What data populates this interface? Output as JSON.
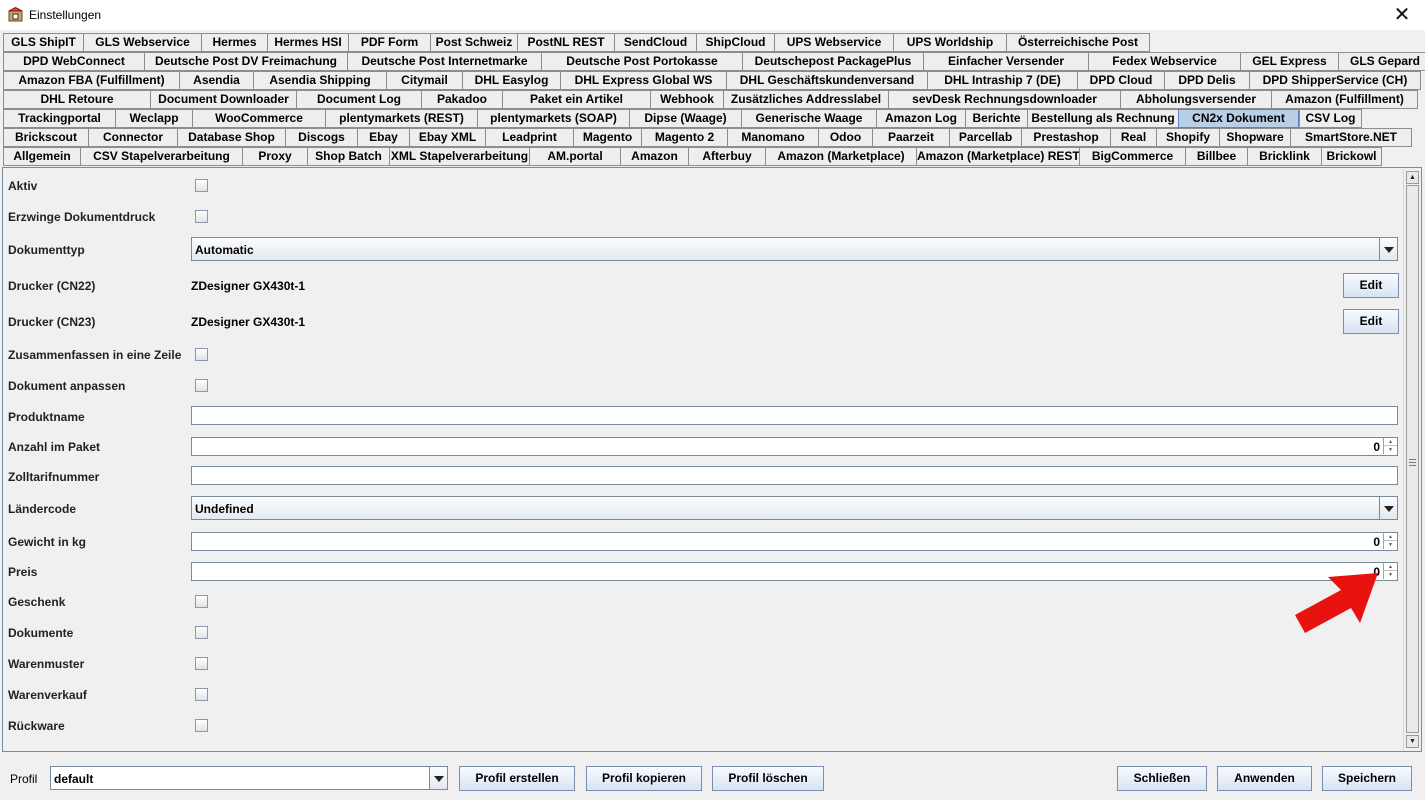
{
  "window": {
    "title": "Einstellungen",
    "close_glyph": "✕"
  },
  "tabs": {
    "row1": [
      "GLS ShipIT",
      "GLS Webservice",
      "Hermes",
      "Hermes HSI",
      "PDF Form",
      "Post Schweiz",
      "PostNL REST",
      "SendCloud",
      "ShipCloud",
      "UPS Webservice",
      "UPS Worldship",
      "Österreichische Post"
    ],
    "row2": [
      "DPD WebConnect",
      "Deutsche Post DV Freimachung",
      "Deutsche Post Internetmarke",
      "Deutsche Post Portokasse",
      "Deutschepost PackagePlus",
      "Einfacher Versender",
      "Fedex Webservice",
      "GEL Express",
      "GLS Gepard"
    ],
    "row3": [
      "Amazon FBA (Fulfillment)",
      "Asendia",
      "Asendia Shipping",
      "Citymail",
      "DHL Easylog",
      "DHL Express Global WS",
      "DHL Geschäftskundenversand",
      "DHL Intraship 7 (DE)",
      "DPD Cloud",
      "DPD Delis",
      "DPD ShipperService (CH)"
    ],
    "row4": [
      "DHL Retoure",
      "Document Downloader",
      "Document Log",
      "Pakadoo",
      "Paket ein Artikel",
      "Webhook",
      "Zusätzliches Addresslabel",
      "sevDesk Rechnungsdownloader",
      "Abholungsversender",
      "Amazon (Fulfillment)"
    ],
    "row5": [
      "Trackingportal",
      "Weclapp",
      "WooCommerce",
      "plentymarkets (REST)",
      "plentymarkets (SOAP)",
      "Dipse (Waage)",
      "Generische Waage",
      "Amazon Log",
      "Berichte",
      "Bestellung als Rechnung",
      "CN2x Dokument",
      "CSV Log"
    ],
    "row6": [
      "Brickscout",
      "Connector",
      "Database Shop",
      "Discogs",
      "Ebay",
      "Ebay XML",
      "Leadprint",
      "Magento",
      "Magento 2",
      "Manomano",
      "Odoo",
      "Paarzeit",
      "Parcellab",
      "Prestashop",
      "Real",
      "Shopify",
      "Shopware",
      "SmartStore.NET"
    ],
    "row7": [
      "Allgemein",
      "CSV Stapelverarbeitung",
      "Proxy",
      "Shop Batch",
      "XML Stapelverarbeitung",
      "AM.portal",
      "Amazon",
      "Afterbuy",
      "Amazon (Marketplace)",
      "Amazon (Marketplace) REST",
      "BigCommerce",
      "Billbee",
      "Bricklink",
      "Brickowl"
    ],
    "selected": "CN2x Dokument"
  },
  "form": {
    "aktiv": "Aktiv",
    "erzwinge": "Erzwinge Dokumentdruck",
    "dokumenttyp_label": "Dokumenttyp",
    "dokumenttyp_value": "Automatic",
    "drucker_cn22_label": "Drucker (CN22)",
    "drucker_cn22_value": "ZDesigner GX430t-1",
    "drucker_cn23_label": "Drucker (CN23)",
    "drucker_cn23_value": "ZDesigner GX430t-1",
    "edit_label": "Edit",
    "zusammenfassen": "Zusammenfassen in eine Zeile",
    "dokument_anpassen": "Dokument anpassen",
    "produktname": "Produktname",
    "anzahl_label": "Anzahl im Paket",
    "anzahl_value": "0",
    "zolltarif": "Zolltarifnummer",
    "laendercode_label": "Ländercode",
    "laendercode_value": "Undefined",
    "gewicht_label": "Gewicht in kg",
    "gewicht_value": "0",
    "preis_label": "Preis",
    "preis_value": "0",
    "geschenk": "Geschenk",
    "dokumente": "Dokumente",
    "warenmuster": "Warenmuster",
    "warenverkauf": "Warenverkauf",
    "rueckware": "Rückware"
  },
  "bottom": {
    "profil_label": "Profil",
    "profil_value": "default",
    "erstellen": "Profil erstellen",
    "kopieren": "Profil kopieren",
    "loeschen": "Profil löschen",
    "schliessen": "Schließen",
    "anwenden": "Anwenden",
    "speichern": "Speichern"
  },
  "colors": {
    "selected_tab": "#b8cfe5",
    "annotation_arrow": "#e8120f"
  }
}
